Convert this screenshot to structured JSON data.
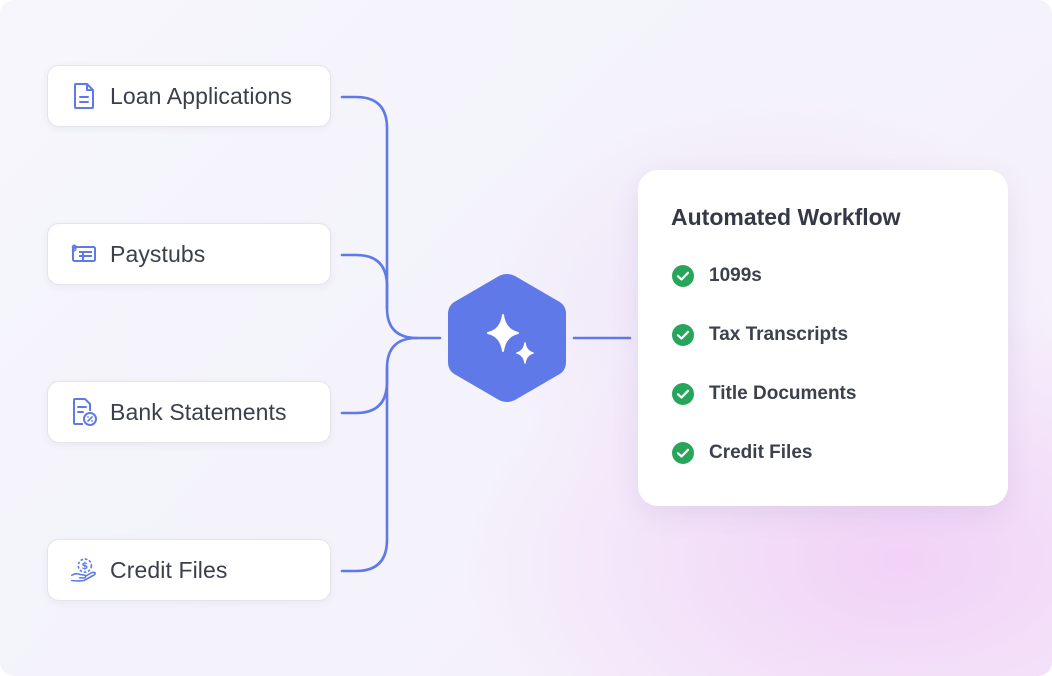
{
  "sources": [
    {
      "label": "Loan Applications",
      "icon": "document-icon"
    },
    {
      "label": "Paystubs",
      "icon": "paystub-icon"
    },
    {
      "label": "Bank Statements",
      "icon": "statement-percent-icon"
    },
    {
      "label": "Credit Files",
      "icon": "hand-dollar-icon"
    }
  ],
  "hub": {
    "icon": "sparkle-icon"
  },
  "workflow": {
    "title": "Automated Workflow",
    "items": [
      {
        "label": "1099s"
      },
      {
        "label": "Tax Transcripts"
      },
      {
        "label": "Title Documents"
      },
      {
        "label": "Credit Files"
      }
    ]
  },
  "colors": {
    "accent": "#5f7ae8",
    "check": "#27a65b",
    "text": "#3a3f4b"
  }
}
